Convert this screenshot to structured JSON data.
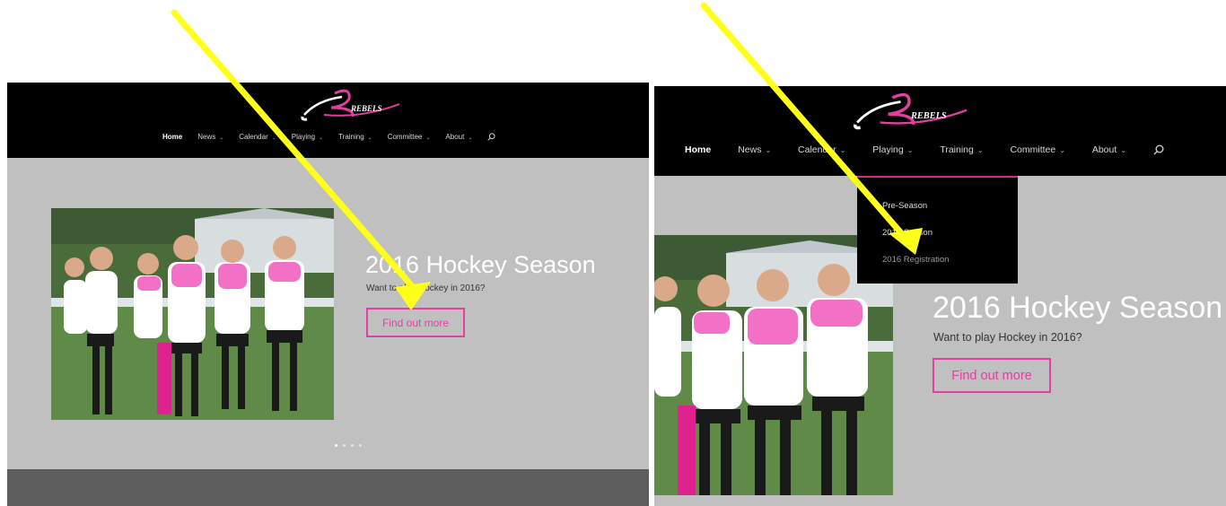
{
  "site": {
    "logo_text": "REBELS",
    "nav": [
      {
        "label": "Home",
        "active": true,
        "has_dropdown": false
      },
      {
        "label": "News",
        "active": false,
        "has_dropdown": true
      },
      {
        "label": "Calendar",
        "active": false,
        "has_dropdown": true
      },
      {
        "label": "Playing",
        "active": false,
        "has_dropdown": true
      },
      {
        "label": "Training",
        "active": false,
        "has_dropdown": true
      },
      {
        "label": "Committee",
        "active": false,
        "has_dropdown": true
      },
      {
        "label": "About",
        "active": false,
        "has_dropdown": true
      }
    ],
    "search_icon": "search-icon",
    "hero": {
      "title": "2016 Hockey Season",
      "subtitle": "Want to play Hockey in 2016?",
      "cta_label": "Find out more"
    },
    "slider": {
      "dot_count": 4,
      "active_index": 0
    }
  },
  "right_panel": {
    "dropdown_items": [
      "Pre-Season",
      "2016 Season",
      "2016 Registration"
    ]
  },
  "colors": {
    "header_bg": "#000000",
    "hero_bg": "#c0c0c0",
    "accent_pink": "#e040a0",
    "arrow_yellow": "#ffff1a",
    "footer_band": "#5d5d5d"
  }
}
